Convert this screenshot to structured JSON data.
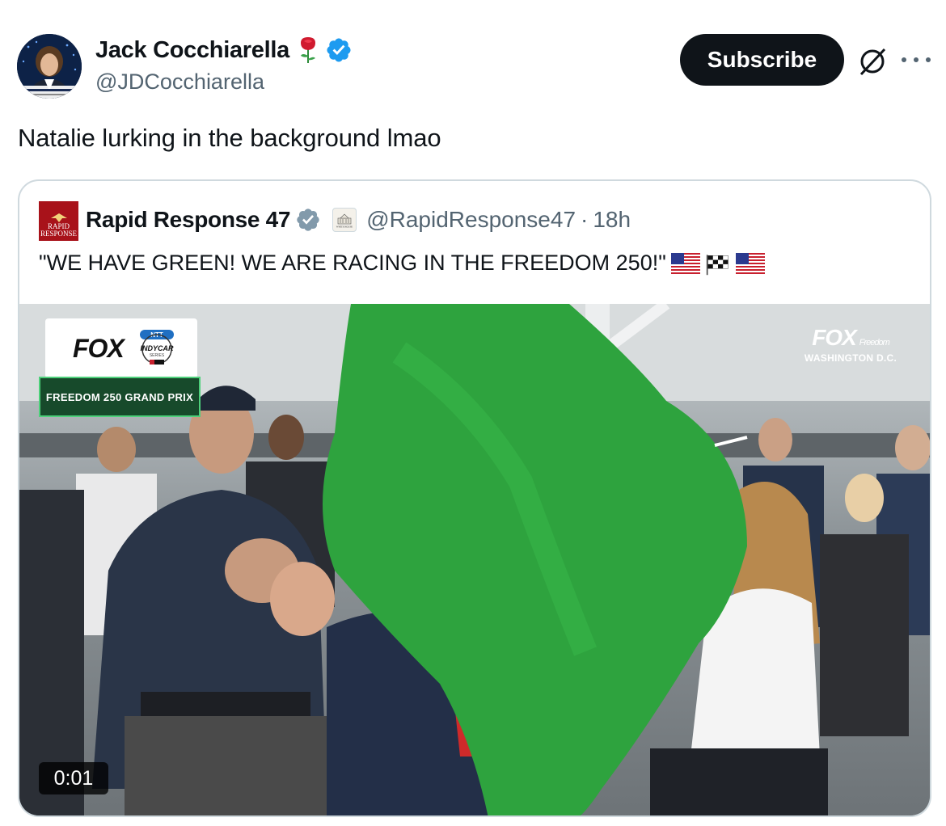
{
  "author": {
    "name": "Jack Cocchiarella",
    "handle": "@JDCocchiarella",
    "name_emoji": "rose-icon",
    "verified": true
  },
  "actions": {
    "subscribe_label": "Subscribe",
    "grok_icon": "grok-icon",
    "more_icon": "more-icon"
  },
  "tweet": {
    "text": "Natalie lurking in the background lmao"
  },
  "quoted_tweet": {
    "logo_text_1": "RAPID",
    "logo_text_2": "RESPONSE",
    "name": "Rapid Response 47",
    "verified": true,
    "affiliation_badge": "white-house-icon",
    "affiliation_badge_text": "WHITE HOUSE",
    "handle": "@RapidResponse47",
    "separator": "·",
    "time": "18h",
    "text": "\"WE HAVE GREEN! WE ARE RACING IN THE FREEDOM 250!\"",
    "emojis": [
      "us-flag-icon",
      "checkered-flag-icon",
      "us-flag-icon"
    ]
  },
  "video": {
    "overlay_left_network": "FOX",
    "overlay_left_series_top": "NTT",
    "overlay_left_series": "INDYCAR",
    "overlay_left_series_sub": "SERIES",
    "overlay_left_event": "FREEDOM 250 GRAND PRIX",
    "overlay_right_network": "FOX",
    "overlay_right_tag": "Freedom",
    "overlay_right_location": "WASHINGTON D.C.",
    "timecode": "0:01"
  },
  "colors": {
    "subscribe_bg": "#0f1419",
    "verified_blue": "#1d9bf0",
    "verified_gray": "#829aab",
    "muted_text": "#536471",
    "border": "#cfd9de",
    "flag_green": "#2ea33e"
  }
}
